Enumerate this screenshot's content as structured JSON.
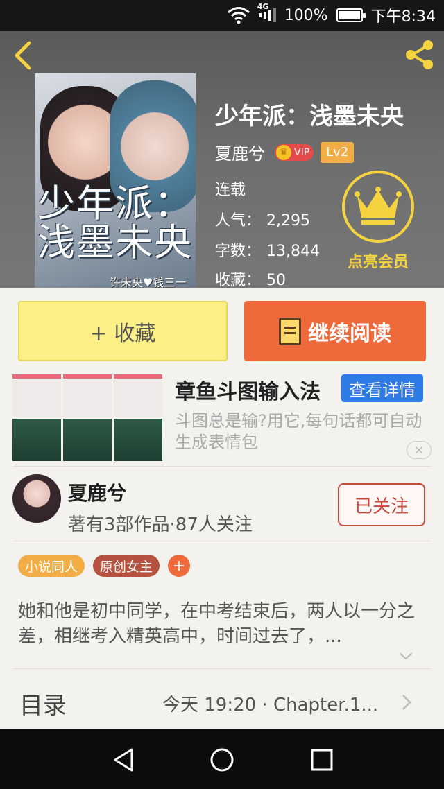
{
  "status_bar": {
    "network": "4G",
    "battery": "100%",
    "time": "下午8:34"
  },
  "book": {
    "cover_title": "少年派：浅墨未央",
    "cover_subtitle": "许未央♥钱三一",
    "title": "少年派：浅墨未央",
    "author": "夏鹿兮",
    "vip_label": "VIP",
    "level": "Lv2",
    "status": "连载",
    "popularity_label": "人气：",
    "popularity": "2,295",
    "wordcount_label": "字数：",
    "wordcount": "13,844",
    "favorites_label": "收藏：",
    "favorites": "50"
  },
  "member": {
    "label": "点亮会员"
  },
  "actions": {
    "collect_label": "+ 收藏",
    "read_label": "继续阅读"
  },
  "ad": {
    "title": "章鱼斗图输入法",
    "detail_button": "查看详情",
    "description": "斗图总是输?用它,每句话都可自动生成表情包"
  },
  "author_card": {
    "name": "夏鹿兮",
    "stats": "著有3部作品·87人关注",
    "follow_button": "已关注"
  },
  "tags": [
    "小说同人",
    "原创女主",
    "+"
  ],
  "synopsis": "她和他是初中同学，在中考结束后，两人以一分之差，相继考入精英高中，时间过去了，...",
  "toc": {
    "label": "目录",
    "latest": "今天 19:20 · Chapter.1..."
  },
  "colors": {
    "accent_orange": "#ee6a3a",
    "collect_yellow": "#fbef86",
    "member_gold": "#f5d340",
    "follow_red": "#c74738",
    "ad_blue": "#2f7be6"
  }
}
